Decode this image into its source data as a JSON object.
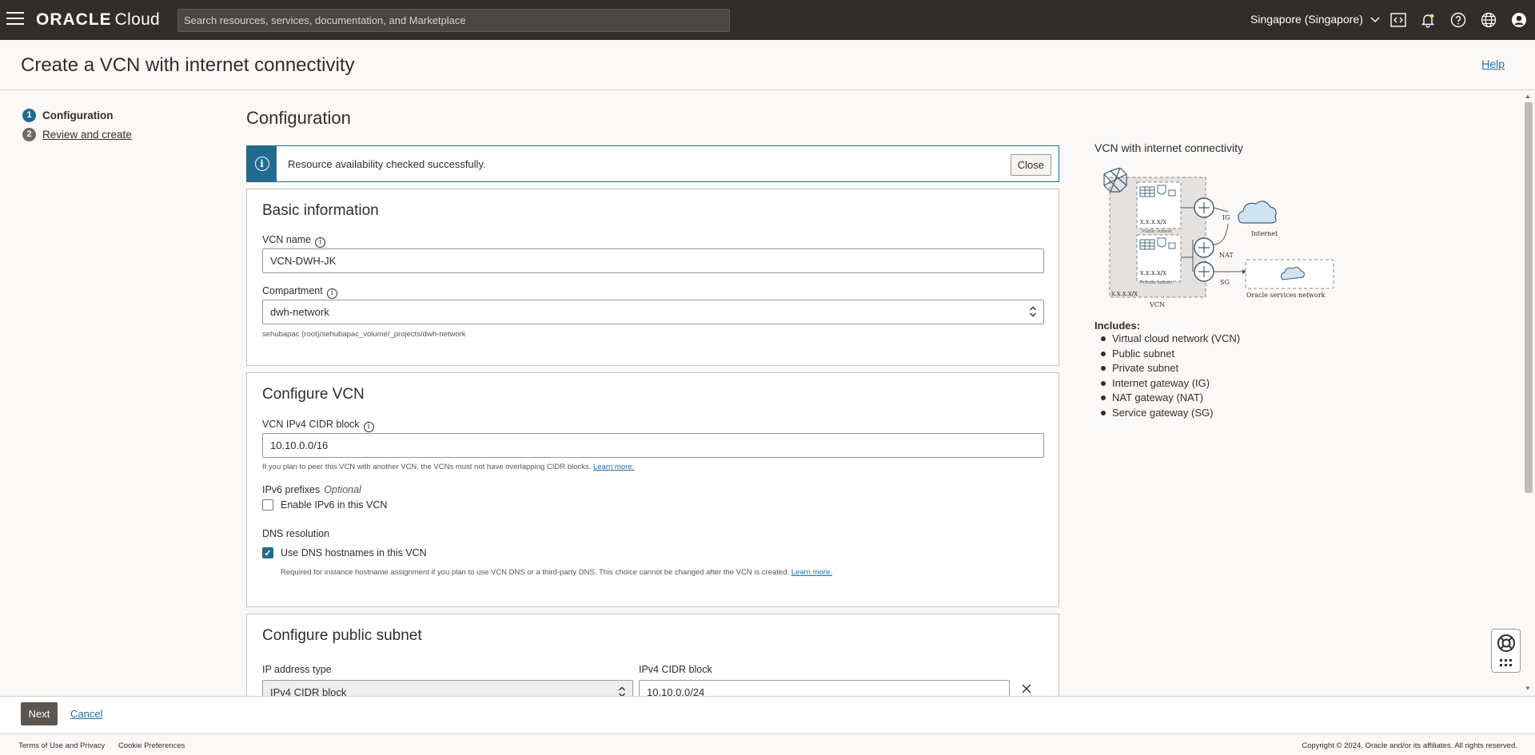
{
  "topbar": {
    "logo_oracle": "ORACLE",
    "logo_cloud": "Cloud",
    "search_placeholder": "Search resources, services, documentation, and Marketplace",
    "region": "Singapore (Singapore)"
  },
  "page": {
    "title": "Create a VCN with internet connectivity",
    "help": "Help"
  },
  "steps": [
    {
      "num": "1",
      "label": "Configuration"
    },
    {
      "num": "2",
      "label": "Review and create"
    }
  ],
  "main": {
    "section_title": "Configuration",
    "alert": {
      "text": "Resource availability checked successfully.",
      "close": "Close"
    },
    "basic": {
      "title": "Basic information",
      "vcn_name_label": "VCN name",
      "vcn_name_value": "VCN-DWH-JK",
      "compartment_label": "Compartment",
      "compartment_value": "dwh-network",
      "compartment_path": "sehubapac (root)/sehubapac_volume/_projects/dwh-network"
    },
    "vcn": {
      "title": "Configure VCN",
      "cidr_label": "VCN IPv4 CIDR block",
      "cidr_value": "10.10.0.0/16",
      "cidr_help": "If you plan to peer this VCN with another VCN, the VCNs must not have overlapping CIDR blocks.",
      "learn_more": "Learn more.",
      "ipv6_label": "IPv6 prefixes",
      "ipv6_optional": "Optional",
      "ipv6_check": "Enable IPv6 in this VCN",
      "dns_label": "DNS resolution",
      "dns_check": "Use DNS hostnames in this VCN",
      "dns_help": "Required for instance hostname assignment if you plan to use VCN DNS or a third-party DNS. This choice cannot be changed after the VCN is created.",
      "dns_learn_more": "Learn more."
    },
    "public_subnet": {
      "title": "Configure public subnet",
      "ip_type_label": "IP address type",
      "ip_type_value": "IPv4 CIDR block",
      "cidr_label": "IPv4 CIDR block",
      "cidr_value": "10.10.0.0/24"
    }
  },
  "diagram": {
    "title": "VCN with internet connectivity",
    "labels": {
      "ig": "IG",
      "nat": "NAT",
      "sg": "SG",
      "internet": "Internet",
      "osn": "Oracle services network",
      "vcn": "VCN",
      "cidr": "x.x.x.x/x",
      "public_subnet": "Public subnet",
      "private_subnet": "Private subnet"
    },
    "includes_title": "Includes:",
    "includes": [
      "Virtual cloud network (VCN)",
      "Public subnet",
      "Private subnet",
      "Internet gateway (IG)",
      "NAT gateway (NAT)",
      "Service gateway (SG)"
    ]
  },
  "actions": {
    "next": "Next",
    "cancel": "Cancel"
  },
  "footer": {
    "terms": "Terms of Use and Privacy",
    "cookies": "Cookie Preferences",
    "copyright": "Copyright © 2024, Oracle and/or its affiliates. All rights reserved."
  }
}
